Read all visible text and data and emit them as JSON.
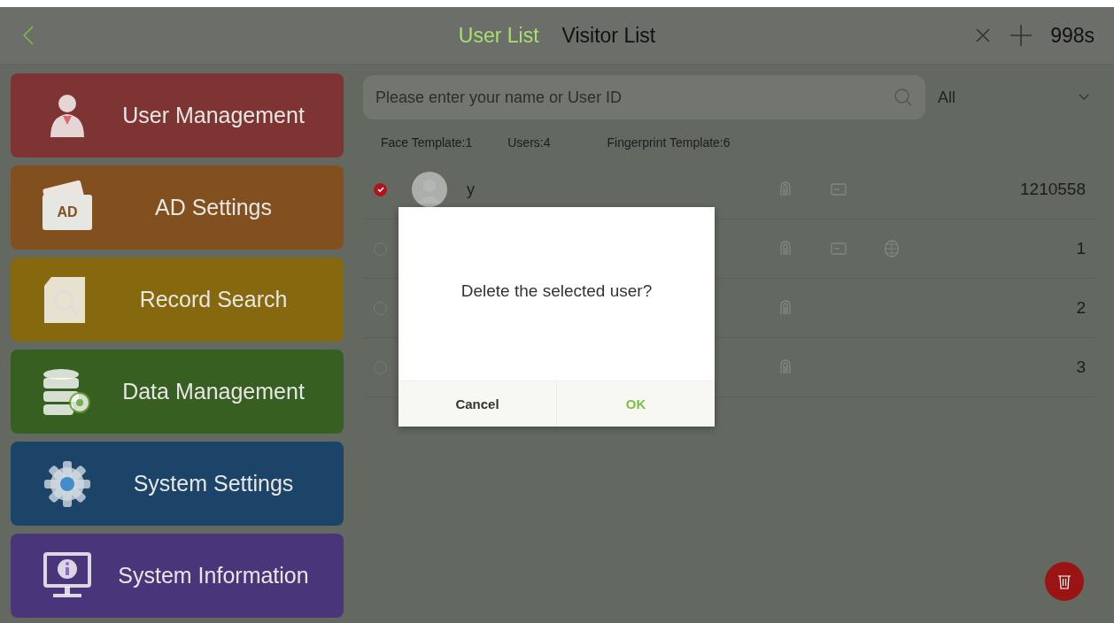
{
  "header": {
    "tabs": [
      {
        "label": "User List",
        "selected": true
      },
      {
        "label": "Visitor List",
        "selected": false
      }
    ],
    "timer": "998s"
  },
  "sidebar": {
    "items": [
      {
        "label": "User Management",
        "kind": "user",
        "color": "#7e3433"
      },
      {
        "label": "AD Settings",
        "kind": "ad",
        "color": "#81501e",
        "badge": "AD"
      },
      {
        "label": "Record Search",
        "kind": "record",
        "color": "#86690f"
      },
      {
        "label": "Data Management",
        "kind": "data",
        "color": "#375f21"
      },
      {
        "label": "System Settings",
        "kind": "settings",
        "color": "#1c4469"
      },
      {
        "label": "System Information",
        "kind": "info",
        "color": "#48357a"
      }
    ]
  },
  "search": {
    "placeholder": "Please enter your name or User ID"
  },
  "filter": {
    "value": "All"
  },
  "stats": [
    "Face Template:1",
    "Users:4",
    "Fingerprint Template:6"
  ],
  "rows": [
    {
      "checked": true,
      "name": "y",
      "fingerprint": true,
      "card": true,
      "face": false,
      "id": "1210558"
    },
    {
      "checked": false,
      "fingerprint": true,
      "card": true,
      "face": true,
      "id": "1"
    },
    {
      "checked": false,
      "fingerprint": true,
      "card": false,
      "face": false,
      "id": "2"
    },
    {
      "checked": false,
      "fingerprint": true,
      "card": false,
      "face": false,
      "id": "3"
    }
  ],
  "dialog": {
    "message": "Delete the selected user?",
    "buttons": [
      {
        "label": "Cancel",
        "kind": "cancel"
      },
      {
        "label": "OK",
        "kind": "ok"
      }
    ]
  }
}
